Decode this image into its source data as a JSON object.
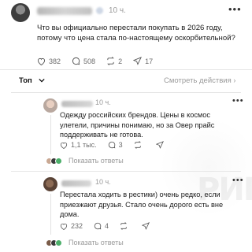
{
  "post": {
    "time": "10 ч.",
    "more": "•••",
    "text": "Что вы официально перестали покупать в 2026 году, потому что цена стала по-настоящему оскорбительной?",
    "likes": "382",
    "comments": "508",
    "reposts": "2",
    "shares": "17"
  },
  "filter": {
    "sort_label": "Топ",
    "watch_label": "Смотреть действия"
  },
  "comments": [
    {
      "time": "10 ч.",
      "text": "Одежду российских брендов. Цены в космос улетели, причины понимаю, но за Овер прайс поддерживать не готова.",
      "likes": "1,1 тыс.",
      "comments": "3",
      "reposts": "",
      "shares": "",
      "show_replies": "Показать ответы"
    },
    {
      "time": "10 ч.",
      "text": "Перестала ходить в рестики) очень редко, если приезжают друзья. Стало очень дорого есть вне дома.",
      "likes": "232",
      "comments": "4",
      "reposts": "",
      "shares": "",
      "show_replies": "Показать ответы"
    }
  ],
  "watermark": "РИП"
}
